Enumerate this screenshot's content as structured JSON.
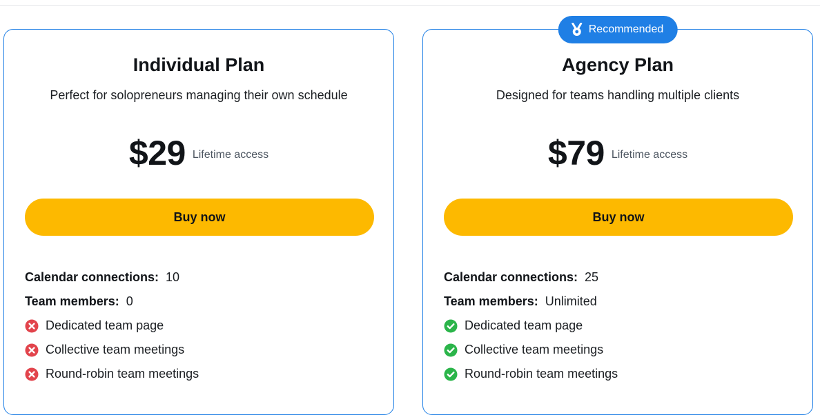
{
  "plans": [
    {
      "title": "Individual Plan",
      "description": "Perfect for solopreneurs managing their own schedule",
      "price": "$29",
      "price_note": "Lifetime access",
      "cta_label": "Buy now",
      "calendar_connections_label": "Calendar connections:",
      "calendar_connections_value": "10",
      "team_members_label": "Team members:",
      "team_members_value": "0",
      "features": [
        {
          "label": "Dedicated team page",
          "included": false,
          "icon": "x-circle-icon"
        },
        {
          "label": "Collective team meetings",
          "included": false,
          "icon": "x-circle-icon"
        },
        {
          "label": "Round-robin team meetings",
          "included": false,
          "icon": "x-circle-icon"
        }
      ]
    },
    {
      "badge": "Recommended",
      "badge_icon": "medal-icon",
      "title": "Agency Plan",
      "description": "Designed for teams handling multiple clients",
      "price": "$79",
      "price_note": "Lifetime access",
      "cta_label": "Buy now",
      "calendar_connections_label": "Calendar connections:",
      "calendar_connections_value": "25",
      "team_members_label": "Team members:",
      "team_members_value": "Unlimited",
      "features": [
        {
          "label": "Dedicated team page",
          "included": true,
          "icon": "check-circle-icon"
        },
        {
          "label": "Collective team meetings",
          "included": true,
          "icon": "check-circle-icon"
        },
        {
          "label": "Round-robin team meetings",
          "included": true,
          "icon": "check-circle-icon"
        }
      ]
    }
  ],
  "colors": {
    "accent": "#1f7fe5",
    "cta": "#fdb900",
    "included": "#2bb54a",
    "excluded": "#e2444c"
  }
}
